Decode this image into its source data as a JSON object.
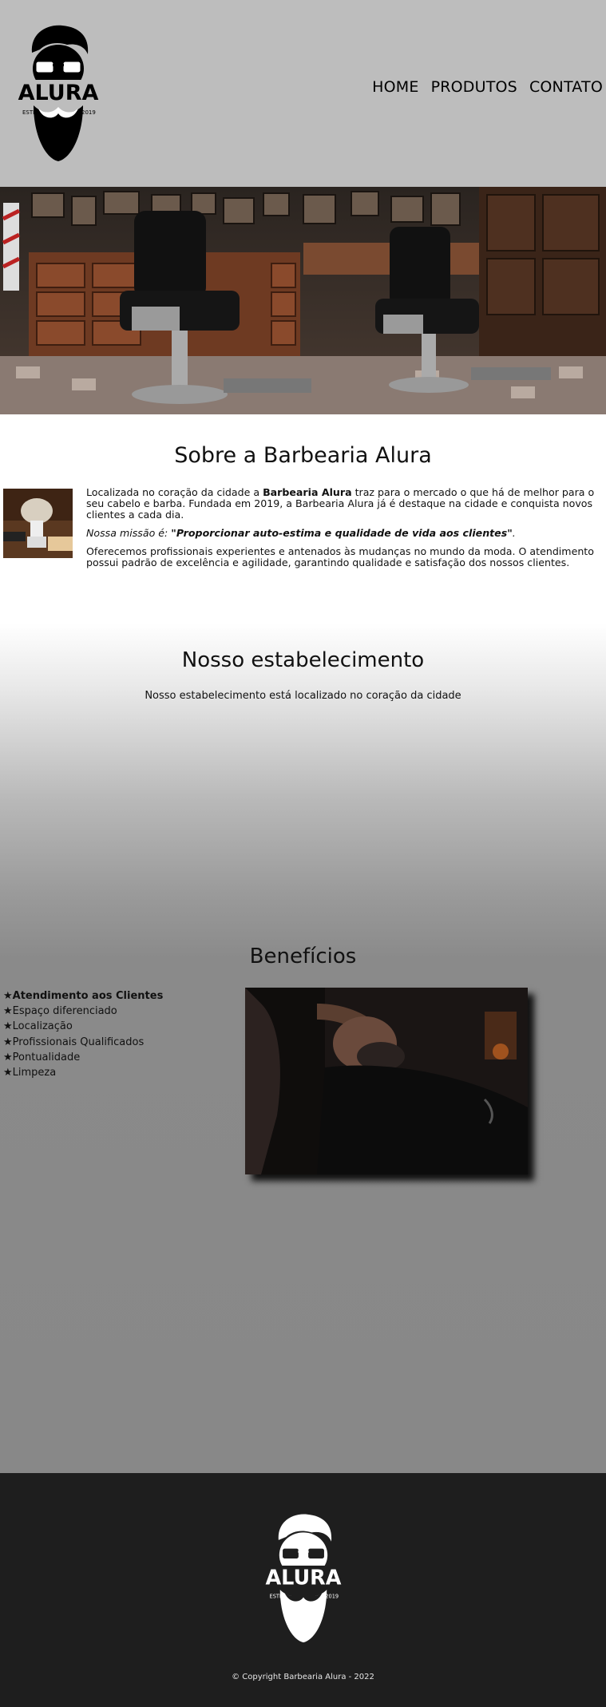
{
  "header": {
    "logo_text": "ALURA",
    "logo_estd": "ESTD",
    "logo_year": "2019",
    "nav": [
      "HOME",
      "PRODUTOS",
      "CONTATO"
    ]
  },
  "sobre": {
    "title": "Sobre a Barbearia Alura",
    "p1_before": "Localizada no coração da cidade a ",
    "p1_bold": "Barbearia Alura",
    "p1_after": " traz para o mercado o que há de melhor para o seu cabelo e barba. Fundada em 2019, a Barbearia Alura já é destaque na cidade e conquista novos clientes a cada dia.",
    "mission_label": "Nossa missão é: ",
    "mission_text": "\"Proporcionar auto-estima e qualidade de vida aos clientes\"",
    "mission_end": ".",
    "p3": "Oferecemos profissionais experientes e antenados às mudanças no mundo da moda. O atendimento possui padrão de excelência e agilidade, garantindo qualidade e satisfação dos nossos clientes."
  },
  "estabelecimento": {
    "title": "Nosso estabelecimento",
    "subtitle": "Nosso estabelecimento está localizado no coração da cidade"
  },
  "beneficios": {
    "title": "Benefícios",
    "items": [
      "★Atendimento aos Clientes",
      "★Espaço diferenciado",
      "★Localização",
      "★Profissionais Qualificados",
      "★Pontualidade",
      "★Limpeza"
    ]
  },
  "footer": {
    "logo_text": "ALURA",
    "logo_estd": "ESTD",
    "logo_year": "2019",
    "copyright": "© Copyright Barbearia Alura - 2022"
  }
}
